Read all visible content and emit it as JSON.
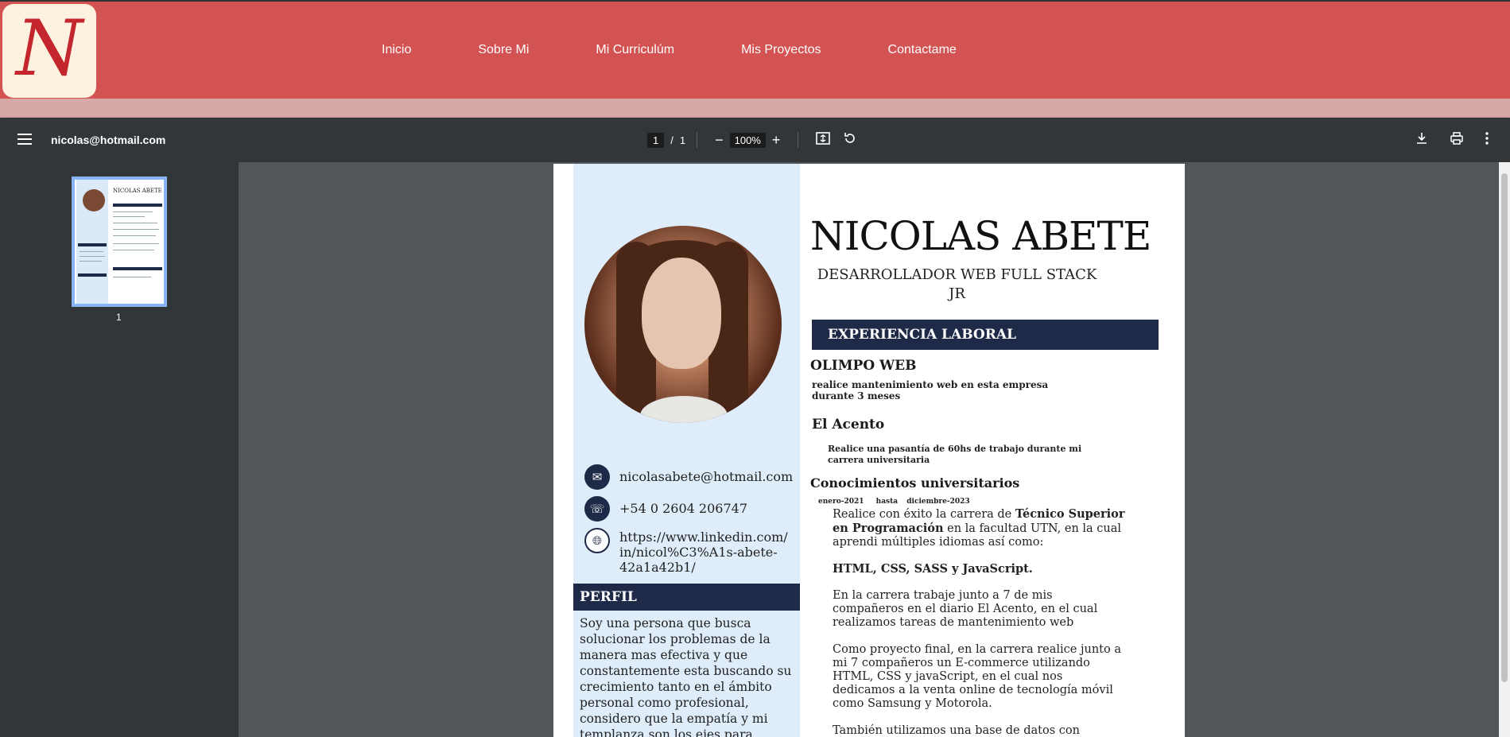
{
  "site": {
    "logo_letter": "N",
    "nav": [
      "Inicio",
      "Sobre Mi",
      "Mi Curriculúm",
      "Mis Proyectos",
      "Contactame"
    ]
  },
  "toolbar": {
    "doc_title": "nicolas@hotmail.com",
    "current_page": "1",
    "page_sep": "/",
    "total_pages": "1",
    "zoom": "100%",
    "minus": "−",
    "plus": "+"
  },
  "sidebar": {
    "thumb_label": "1",
    "thumb_title": "NICOLAS ABETE"
  },
  "cv": {
    "name": "NICOLAS ABETE",
    "role_line1": "DESARROLLADOR WEB FULL STACK",
    "role_line2": "JR",
    "email": "nicolasabete@hotmail.com",
    "phone": "+54 0 2604 206747",
    "linkedin_1": "https://www.linkedin.com/",
    "linkedin_2": "in/nicol%C3%A1s-abete-",
    "linkedin_3": "42a1a42b1/",
    "perfil_title": "PERFIL",
    "perfil_text": "Soy una persona que busca solucionar los problemas de la manera mas efectiva y que constantemente esta buscando su crecimiento tanto en el ámbito personal como profesional, considero que la empatía y mi templanza son los ejes para poder",
    "exp_title": "EXPERIENCIA LABORAL",
    "job1_company": "OLIMPO WEB",
    "job1_line1": "realice mantenimiento web en esta empresa",
    "job1_line2": "durante 3 meses",
    "job2_company": "El Acento",
    "job2_line1": "Realice una pasantía de 60hs de trabajo durante mi",
    "job2_line2": "carrera universitaria",
    "uni_title": "Conocimientos universitarios",
    "uni_from": "enero-2021",
    "uni_hasta": "hasta",
    "uni_to": "diciembre-2023",
    "uni_p1_a": "Realice con éxito la carrera de ",
    "uni_p1_b": "Técnico Superior en Programación",
    "uni_p1_c": " en la facultad UTN, en la cual aprendi múltiples idiomas así como:",
    "uni_langs": "HTML, CSS, SASS y JavaScript.",
    "uni_p2": "En la carrera trabaje junto a 7 de mis compañeros en el diario El Acento, en el cual realizamos tareas de mantenimiento web",
    "uni_p3": "Como proyecto final, en la carrera realice junto a mi 7 compañeros un E-commerce utilizando HTML, CSS y javaScript, en el cual nos dedicamos a la venta online de tecnología móvil como Samsung y Motorola.",
    "uni_p4": "También utilizamos una base de datos con MySQL"
  },
  "colors": {
    "header": "#d35252",
    "navy": "#1e2a47",
    "left_col": "#dfedfa",
    "toolbar": "#323639"
  }
}
